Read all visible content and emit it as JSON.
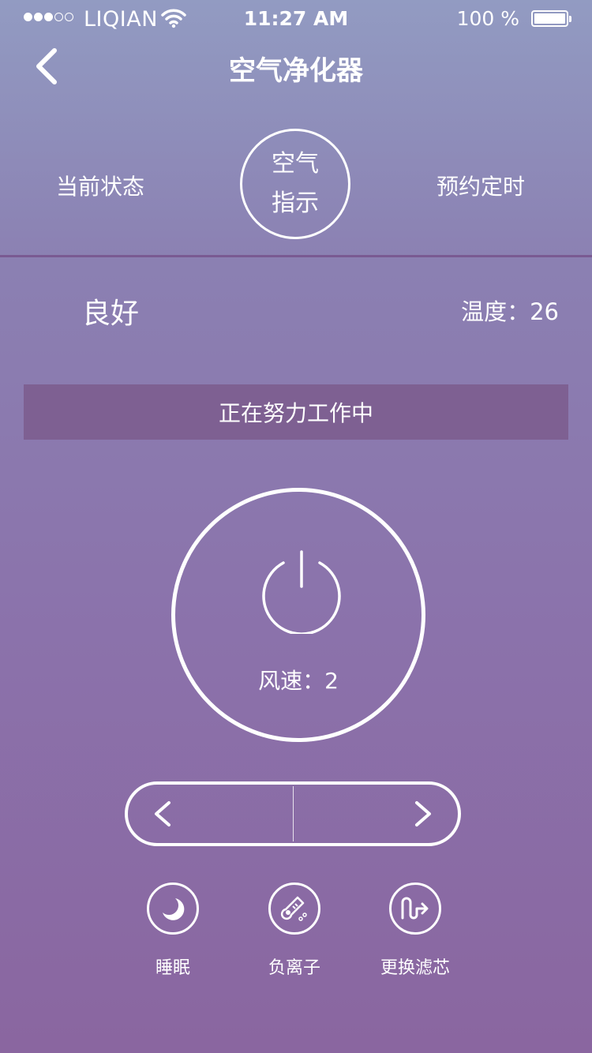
{
  "status_bar": {
    "carrier": "LIQIAN",
    "time": "11:27 AM",
    "battery": "100 %",
    "signal_filled": 3,
    "signal_total": 5
  },
  "nav": {
    "title": "空气净化器",
    "back_icon": "chevron-left-icon"
  },
  "tabs": {
    "left": "当前状态",
    "center_line1": "空气",
    "center_line2": "指示",
    "right": "预约定时"
  },
  "info": {
    "air_quality": "良好",
    "temperature": "温度：26"
  },
  "status_banner": "正在努力工作中",
  "power": {
    "icon": "power-icon",
    "speed": "风速：2"
  },
  "speed_control": {
    "decrease_icon": "chevron-left-icon",
    "increase_icon": "chevron-right-icon"
  },
  "functions": [
    {
      "label": "睡眠",
      "icon": "moon-icon"
    },
    {
      "label": "负离子",
      "icon": "thermometer-icon"
    },
    {
      "label": "更换滤芯",
      "icon": "filter-flow-icon"
    }
  ],
  "colors": {
    "gradient_top": "#929bc2",
    "gradient_bottom": "#8a66a0",
    "banner": "#7e6092",
    "divider": "#7a5a92"
  }
}
